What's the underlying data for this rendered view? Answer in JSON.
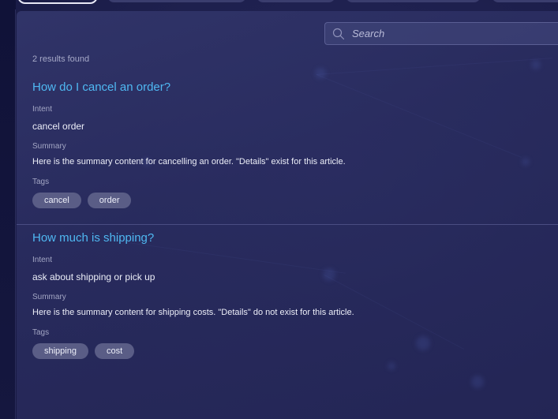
{
  "search": {
    "placeholder": "Search",
    "icon": "search-icon"
  },
  "results": {
    "count_text": "2 results found"
  },
  "labels": {
    "intent": "Intent",
    "summary": "Summary",
    "tags": "Tags"
  },
  "articles": [
    {
      "title": "How do I cancel an order?",
      "intent": "cancel order",
      "summary": "Here is the summary content for cancelling an order. \"Details\" exist for this article.",
      "tags": [
        "cancel",
        "order"
      ]
    },
    {
      "title": "How much is shipping?",
      "intent": "ask about shipping or pick up",
      "summary": "Here is the summary content for shipping costs. \"Details\" do not exist for this article.",
      "tags": [
        "shipping",
        "cost"
      ]
    }
  ],
  "colors": {
    "title_link": "#4fb8f2",
    "tag_bg": "#5a5d86",
    "panel_bg": "#2f3268"
  }
}
